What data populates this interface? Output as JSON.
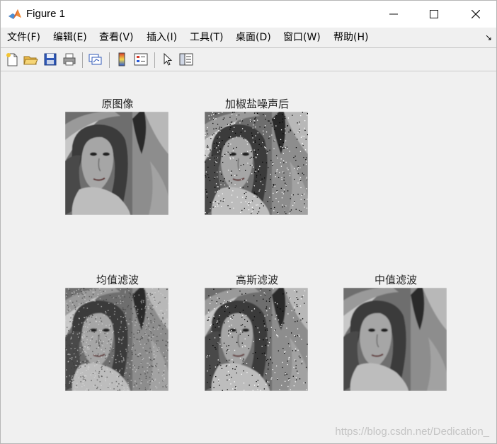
{
  "window": {
    "title": "Figure 1"
  },
  "menu": {
    "items": [
      "文件(F)",
      "编辑(E)",
      "查看(V)",
      "插入(I)",
      "工具(T)",
      "桌面(D)",
      "窗口(W)",
      "帮助(H)"
    ]
  },
  "toolbar": {
    "icons": [
      "new-figure-icon",
      "open-file-icon",
      "save-icon",
      "print-icon",
      "link-plot-icon",
      "colorbar-icon",
      "legend-icon",
      "pointer-icon",
      "property-editor-icon"
    ]
  },
  "subplots": [
    {
      "title": "原图像",
      "variant": "original"
    },
    {
      "title": "加椒盐噪声后",
      "variant": "salt-pepper"
    },
    {
      "title": "均值滤波",
      "variant": "mean"
    },
    {
      "title": "高斯滤波",
      "variant": "gaussian"
    },
    {
      "title": "中值滤波",
      "variant": "median"
    }
  ],
  "watermark": "https://blog.csdn.net/Dedication_"
}
